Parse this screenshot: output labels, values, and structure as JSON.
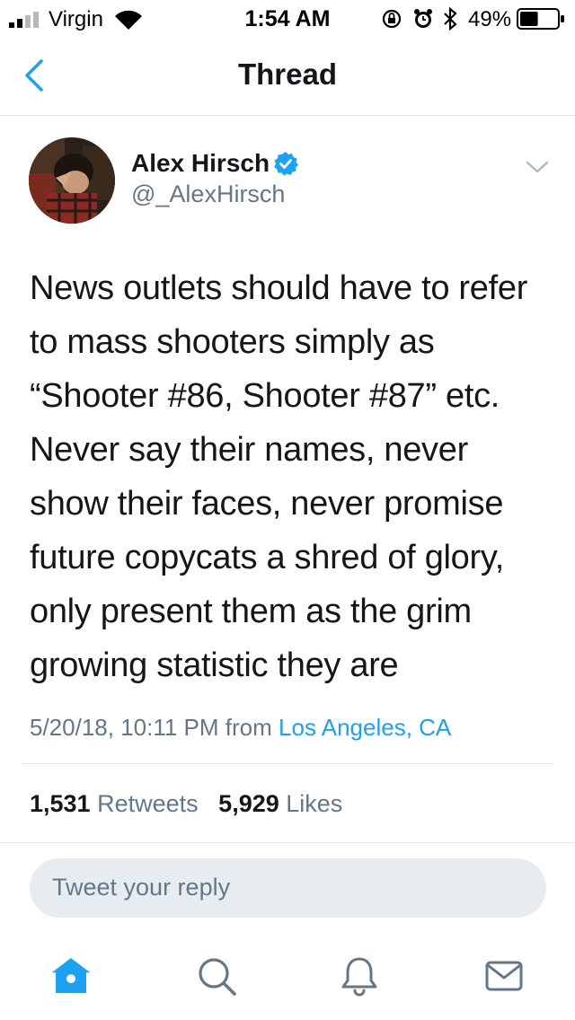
{
  "status_bar": {
    "carrier": "Virgin",
    "time": "1:54 AM",
    "battery_percent": "49%",
    "battery_level": 0.49
  },
  "nav": {
    "title": "Thread",
    "back_icon": "chevron-left-icon"
  },
  "tweet": {
    "author_name": "Alex Hirsch",
    "author_handle": "@_AlexHirsch",
    "verified": true,
    "text_lines": [
      "News outlets should have to refer",
      "to mass shooters simply as",
      "“Shooter #86, Shooter #87” etc.",
      "Never say their names, never",
      "show their faces, never promise",
      "future copycats a shred of glory,",
      "only present them as the grim",
      "growing statistic they are"
    ],
    "timestamp": "5/20/18, 10:11 PM",
    "from_label": "from",
    "location": "Los Angeles, CA",
    "retweets_count": "1,531",
    "retweets_label": "Retweets",
    "likes_count": "5,929",
    "likes_label": "Likes"
  },
  "reply": {
    "placeholder": "Tweet your reply"
  },
  "tab_bar": {
    "items": [
      "home-icon",
      "search-icon",
      "notifications-icon",
      "messages-icon"
    ]
  },
  "colors": {
    "accent": "#1da1f2",
    "text": "#14171a",
    "secondary_text": "#657786",
    "reply_bg": "#e6ecf0"
  }
}
